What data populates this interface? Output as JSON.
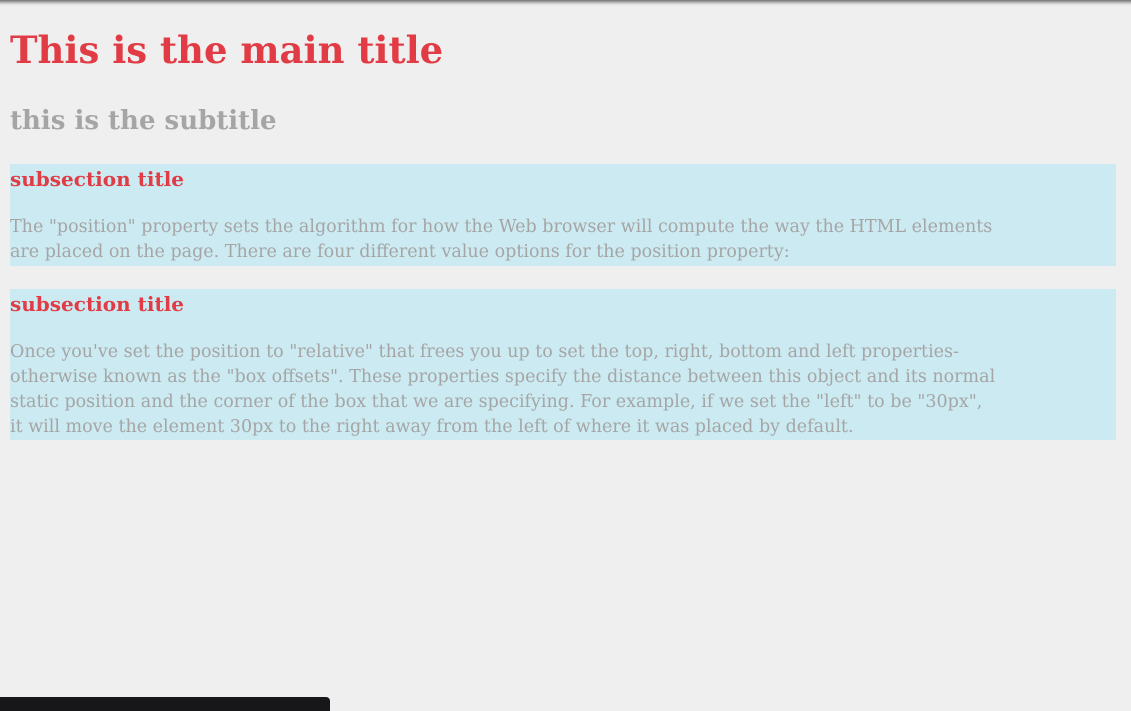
{
  "colors": {
    "title": "#e13c46",
    "subtitle": "#a5a5a5",
    "body_text": "#a5a5a5",
    "section_bg": "#cbeaf1",
    "page_bg": "#efefef",
    "bottom_bar": "#17171a"
  },
  "page": {
    "main_title": "This is the main title",
    "subtitle": "this is the subtitle"
  },
  "sections": [
    {
      "title": "subsection title",
      "text": "The \"position\" property sets the algorithm for how the Web browser will compute the way the HTML elements are placed on the page. There are four different value options for the position property:"
    },
    {
      "title": "subsection title",
      "text": "Once you've set the position to \"relative\" that frees you up to set the top, right, bottom and left properties- otherwise known as the \"box offsets\". These properties specify the distance between this object and its normal static position and the corner of the box that we are specifying. For example, if we set the \"left\" to be \"30px\", it will move the element 30px to the right away from the left of where it was placed by default."
    }
  ]
}
